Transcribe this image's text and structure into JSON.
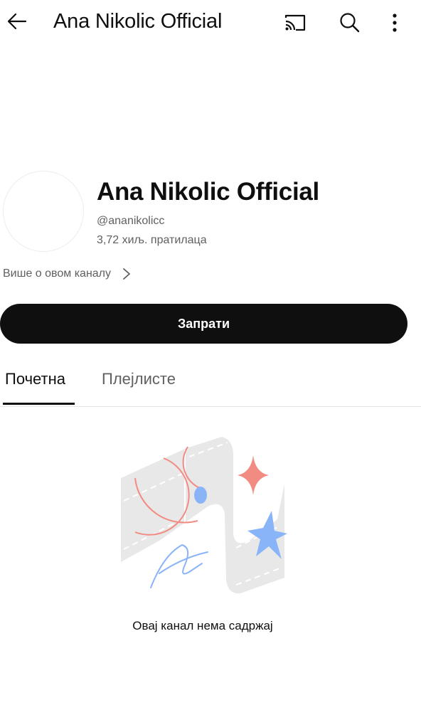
{
  "topbar": {
    "title": "Ana Nikolic Official",
    "icons": [
      "back-arrow-icon",
      "cast-icon",
      "search-icon",
      "more-vert-icon"
    ]
  },
  "channel": {
    "name": "Ana Nikolic Official",
    "handle": "@ananikolicc",
    "subscribers": "3,72 хиљ. пратилаца",
    "about_label": "Више о овом каналу",
    "subscribe_label": "Запрати"
  },
  "tabs": [
    {
      "label": "Почетна",
      "active": true
    },
    {
      "label": "Плејлисте",
      "active": false
    }
  ],
  "empty_state": {
    "message": "Овај канал нема садржај",
    "colors": {
      "shape": "#e8e8e8",
      "red_accent": "#f28b82",
      "blue_accent": "#8ab4f8"
    }
  },
  "colors": {
    "primary_text": "#0f0f0f",
    "secondary_text": "#606060",
    "subscribe_bg": "#0f0f0f",
    "subscribe_text": "#ffffff"
  }
}
